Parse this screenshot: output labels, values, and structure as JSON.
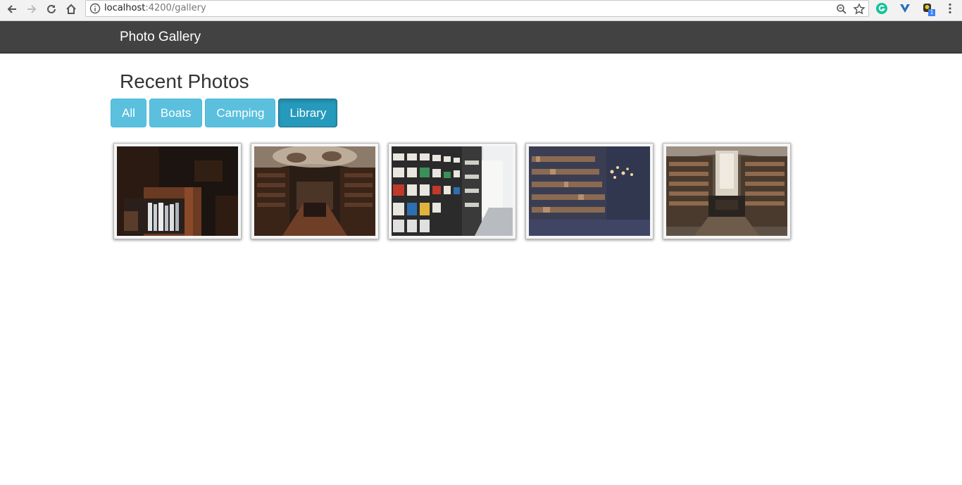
{
  "browser": {
    "url_host": "localhost",
    "url_path": ":4200/gallery",
    "icons": [
      "back-icon",
      "forward-icon",
      "reload-icon",
      "home-icon",
      "info-icon",
      "zoom-icon",
      "star-icon",
      "grammarly-icon",
      "vimium-icon",
      "extension-icon",
      "menu-icon"
    ],
    "extension_badge": "1"
  },
  "navbar": {
    "brand": "Photo Gallery"
  },
  "main": {
    "title": "Recent Photos",
    "filters": [
      {
        "label": "All",
        "active": false
      },
      {
        "label": "Boats",
        "active": false
      },
      {
        "label": "Camping",
        "active": false
      },
      {
        "label": "Library",
        "active": true
      }
    ],
    "photos": [
      {
        "subject": "library-shelf-closeup"
      },
      {
        "subject": "ornate-library-hall"
      },
      {
        "subject": "library-stacks-aisle"
      },
      {
        "subject": "library-shelves-with-lights"
      },
      {
        "subject": "library-hall-long-view"
      }
    ]
  },
  "colors": {
    "navbar": "#424242",
    "filter_button": "#5bc0de",
    "filter_button_active": "#269abc"
  }
}
